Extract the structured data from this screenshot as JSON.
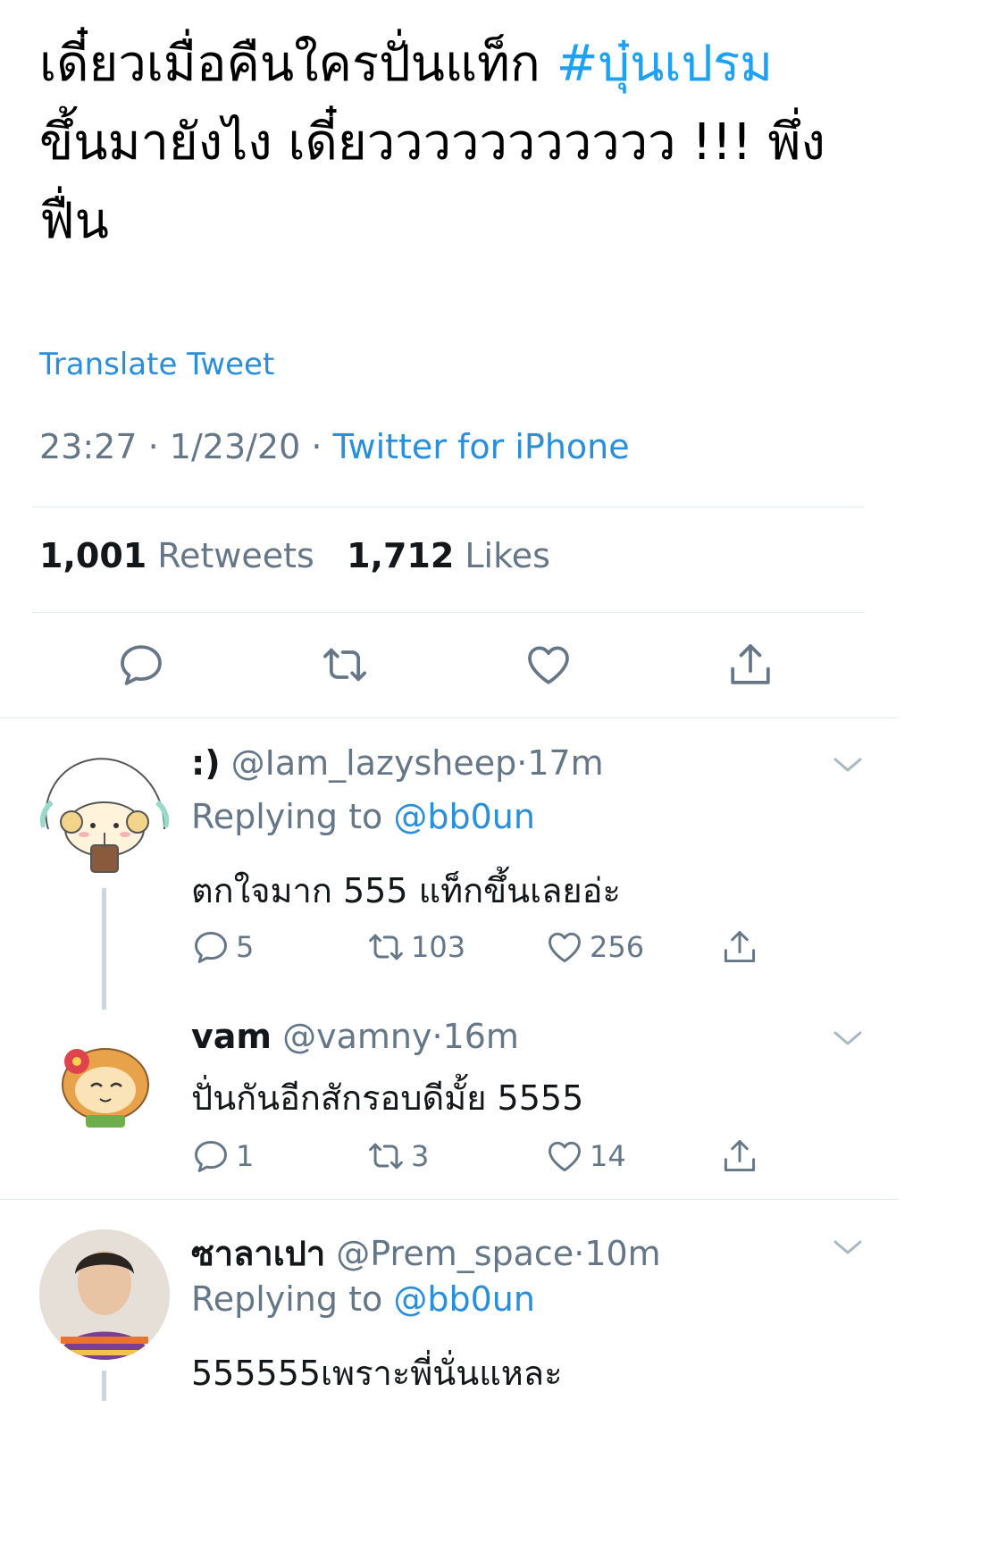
{
  "tweet": {
    "text_before_hashtag": "เดี๋ยวเมื่อคืนใครปั่นแท็ก ",
    "hashtag": "#บุ๋นเปรม",
    "text_after_hashtag": " ขึ้นมายังไง เดี๋ยววววววววววว !!! พึ่งฟื่น",
    "translate_label": "Translate Tweet",
    "time": "23:27",
    "date": "1/23/20",
    "separator": "·",
    "source": "Twitter for iPhone"
  },
  "stats": {
    "retweets_count": "1,001",
    "retweets_label": "Retweets",
    "likes_count": "1,712",
    "likes_label": "Likes"
  },
  "actions": {
    "icons": [
      "reply-icon",
      "retweet-icon",
      "like-icon",
      "share-icon"
    ]
  },
  "replies": [
    {
      "name": ":)",
      "handle": "@Iam_lazysheep",
      "separator": "·",
      "time": "17m",
      "replying_prefix": "Replying to",
      "replying_to": "@bb0un",
      "body": "ตกใจมาก 555 แท็กขึ้นเลยอ่ะ",
      "reply_count": "5",
      "retweet_count": "103",
      "like_count": "256",
      "avatar_icon": "sheep-avatar-icon"
    },
    {
      "name": "vam",
      "handle": "@vamny",
      "separator": "·",
      "time": "16m",
      "body": "ปั่นกันอีกสักรอบดีมั้ย 5555",
      "reply_count": "1",
      "retweet_count": "3",
      "like_count": "14",
      "avatar_icon": "monkey-avatar-icon"
    },
    {
      "name": "ซาลาเปา",
      "handle": "@Prem_space",
      "separator": "·",
      "time": "10m",
      "replying_prefix": "Replying to",
      "replying_to": "@bb0un",
      "body": "555555เพราะพี่นั่นแหละ",
      "avatar_icon": "person-photo-avatar"
    }
  ],
  "colors": {
    "link_blue": "#2a8fd8",
    "secondary_gray": "#657786",
    "divider": "#e1e8ed"
  }
}
